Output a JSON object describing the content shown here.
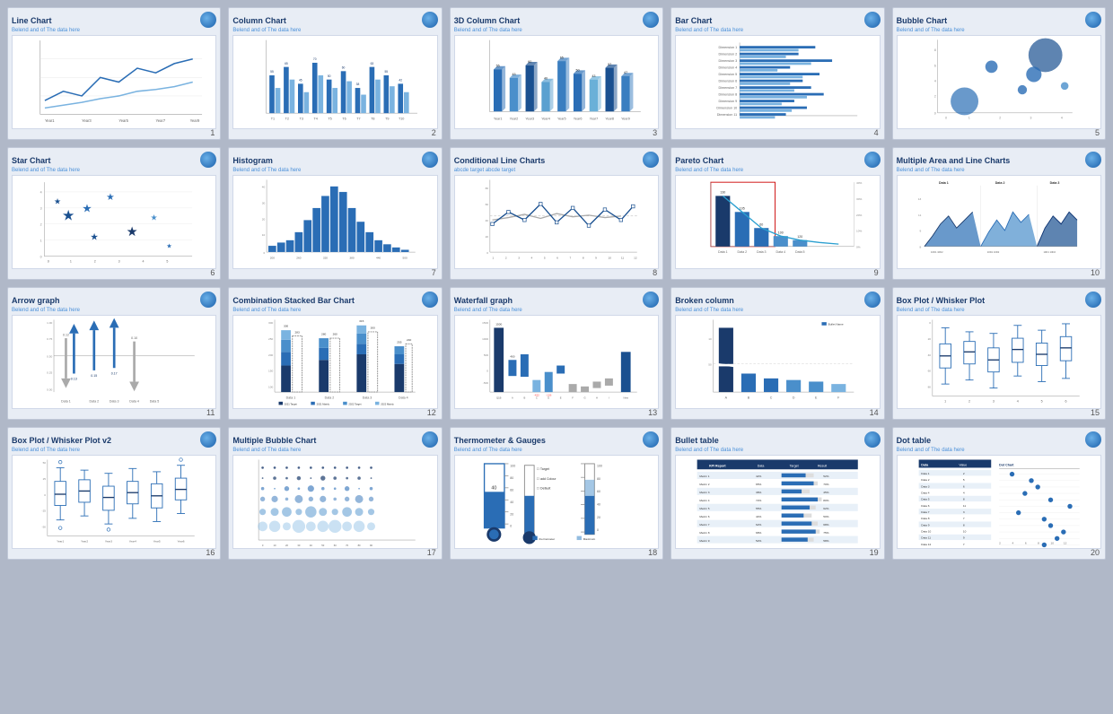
{
  "cards": [
    {
      "id": 1,
      "title": "Line Chart",
      "subtitle": "Belend and of The data here",
      "number": "1",
      "chartType": "line"
    },
    {
      "id": 2,
      "title": "Column Chart",
      "subtitle": "Belend and of The data here",
      "number": "2",
      "chartType": "column"
    },
    {
      "id": 3,
      "title": "3D Column Chart",
      "subtitle": "Belend and of The data here",
      "number": "3",
      "chartType": "3dcolumn"
    },
    {
      "id": 4,
      "title": "Bar Chart",
      "subtitle": "Belend and of The data here",
      "number": "4",
      "chartType": "bar"
    },
    {
      "id": 5,
      "title": "Bubble Chart",
      "subtitle": "Belend and of The data here",
      "number": "5",
      "chartType": "bubble"
    },
    {
      "id": 6,
      "title": "Star Chart",
      "subtitle": "Belend and of The data here",
      "number": "6",
      "chartType": "star"
    },
    {
      "id": 7,
      "title": "Histogram",
      "subtitle": "Belend and of The data here",
      "number": "7",
      "chartType": "histogram"
    },
    {
      "id": 8,
      "title": "Conditional Line Charts",
      "subtitle": "abcde target\nabcde target",
      "number": "8",
      "chartType": "conditionalline"
    },
    {
      "id": 9,
      "title": "Pareto Chart",
      "subtitle": "Belend and of The data here",
      "number": "9",
      "chartType": "pareto"
    },
    {
      "id": 10,
      "title": "Multiple Area and Line Charts",
      "subtitle": "Belend and of The data here",
      "number": "10",
      "chartType": "multiarea"
    },
    {
      "id": 11,
      "title": "Arrow graph",
      "subtitle": "Belend and of The data here",
      "number": "11",
      "chartType": "arrow"
    },
    {
      "id": 12,
      "title": "Combination Stacked Bar Chart",
      "subtitle": "Belend and of The data here",
      "number": "12",
      "chartType": "stackedbar"
    },
    {
      "id": 13,
      "title": "Waterfall graph",
      "subtitle": "Belend and of The data here",
      "number": "13",
      "chartType": "waterfall"
    },
    {
      "id": 14,
      "title": "Broken column",
      "subtitle": "Belend and of The data here",
      "number": "14",
      "chartType": "brokencolumn"
    },
    {
      "id": 15,
      "title": "Box Plot / Whisker Plot",
      "subtitle": "Belend and of The data here",
      "number": "15",
      "chartType": "boxplot"
    },
    {
      "id": 16,
      "title": "Box Plot / Whisker Plot v2",
      "subtitle": "Belend and of The data here",
      "number": "16",
      "chartType": "boxplot2"
    },
    {
      "id": 17,
      "title": "Multiple Bubble Chart",
      "subtitle": "Belend and of The data here",
      "number": "17",
      "chartType": "multibubble"
    },
    {
      "id": 18,
      "title": "Thermometer  & Gauges",
      "subtitle": "Belend and of The data here",
      "number": "18",
      "chartType": "thermometer"
    },
    {
      "id": 19,
      "title": "Bullet table",
      "subtitle": "Belend and of The data here",
      "number": "19",
      "chartType": "bullettable"
    },
    {
      "id": 20,
      "title": "Dot table",
      "subtitle": "Belend and of The data here",
      "number": "20",
      "chartType": "dottable"
    }
  ]
}
